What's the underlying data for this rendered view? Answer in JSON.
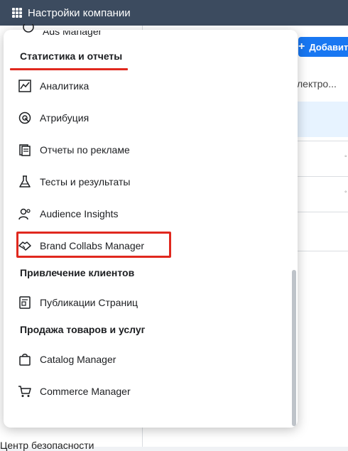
{
  "topbar": {
    "title": "Настройки компании",
    "color": "#3c4b5f"
  },
  "right": {
    "add_label": "Добавить",
    "snippet": "лектро..."
  },
  "left": {
    "security": "Центр безопасности"
  },
  "dropdown": {
    "clipped_item": "Ads Manager",
    "sections": [
      {
        "title": "Статистика и отчеты"
      },
      {
        "title": "Привлечение клиентов"
      },
      {
        "title": "Продажа товаров и услуг"
      }
    ],
    "items": [
      {
        "label": "Аналитика",
        "icon": "analytics-icon"
      },
      {
        "label": "Атрибуция",
        "icon": "attribution-icon"
      },
      {
        "label": "Отчеты по рекламе",
        "icon": "ads-reports-icon"
      },
      {
        "label": "Тесты и результаты",
        "icon": "flask-icon"
      },
      {
        "label": "Audience Insights",
        "icon": "audience-icon"
      },
      {
        "label": "Brand Collabs Manager",
        "icon": "handshake-icon"
      },
      {
        "label": "Публикации Страниц",
        "icon": "page-posts-icon"
      },
      {
        "label": "Catalog Manager",
        "icon": "shopping-bag-icon"
      },
      {
        "label": "Commerce Manager",
        "icon": "cart-icon"
      }
    ]
  },
  "colors": {
    "accent": "#1877f2",
    "highlight": "#e0281e"
  }
}
